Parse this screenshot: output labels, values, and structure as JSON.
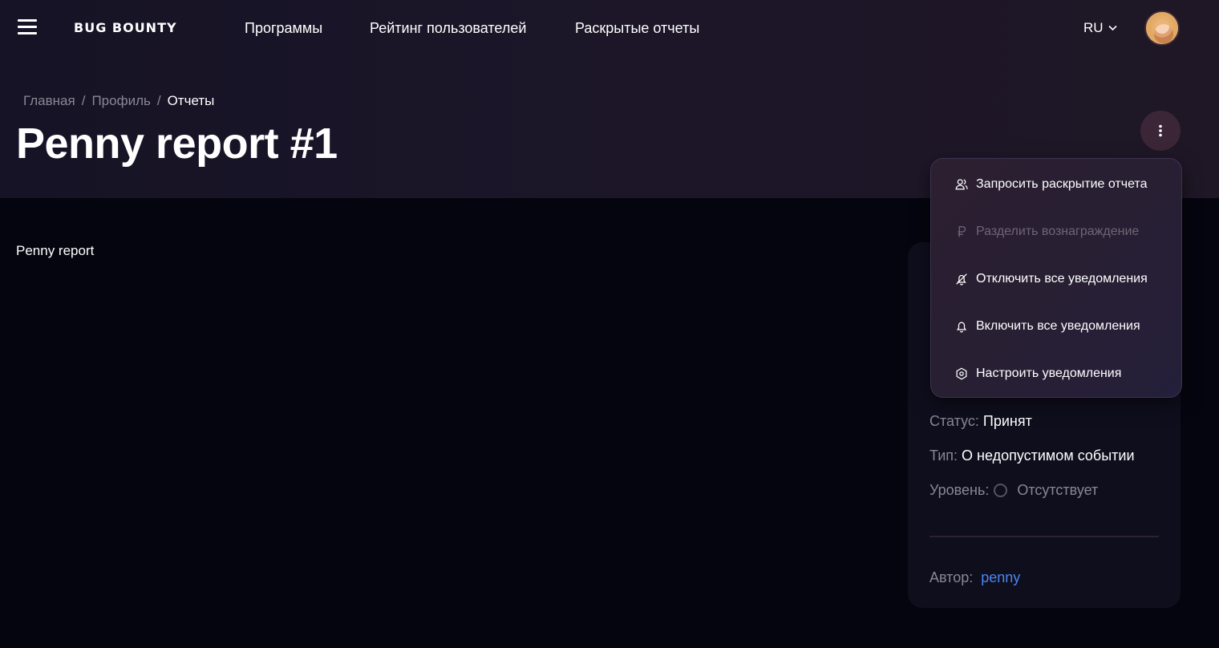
{
  "header": {
    "logo": "BUG BOUNTY",
    "nav": [
      "Программы",
      "Рейтинг пользователей",
      "Раскрытые отчеты"
    ],
    "language": "RU"
  },
  "breadcrumb": {
    "items": [
      "Главная",
      "Профиль",
      "Отчеты"
    ],
    "separator": "/"
  },
  "page": {
    "title": "Penny report #1",
    "body": "Penny report"
  },
  "menu": {
    "items": [
      {
        "label": "Запросить раскрытие отчета",
        "icon": "users-icon",
        "disabled": false
      },
      {
        "label": "Разделить вознаграждение",
        "icon": "ruble-icon",
        "disabled": true
      },
      {
        "label": "Отключить все уведомления",
        "icon": "bell-off-icon",
        "disabled": false
      },
      {
        "label": "Включить все уведомления",
        "icon": "bell-icon",
        "disabled": false
      },
      {
        "label": "Настроить уведомления",
        "icon": "settings-icon",
        "disabled": false
      }
    ]
  },
  "details": {
    "status_label": "Статус:",
    "status_value": "Принят",
    "type_label": "Тип:",
    "type_value": "О недопустимом событии",
    "level_label": "Уровень:",
    "level_value": "Отсутствует",
    "author_label": "Автор:",
    "author_value": "penny"
  },
  "colors": {
    "background": "#05050f",
    "header": "#1c1628",
    "accent_link": "#4a86f0",
    "muted_text": "#8a8794",
    "menu_bg": "#281f33"
  }
}
